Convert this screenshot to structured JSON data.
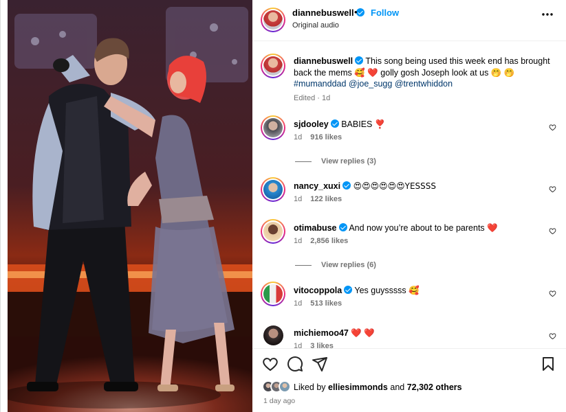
{
  "post": {
    "author": "diannebuswell",
    "follow_label": "Follow",
    "separator": "•",
    "audio": "Original audio",
    "more_label": "•••"
  },
  "caption": {
    "author": "diannebuswell",
    "text": "This song being used this week end has brought back the mems 🥰 ❤️ golly gosh Joseph look at us 🤭 🤭",
    "tags": "#mumanddad @joe_sugg @trentwhiddon",
    "meta": "Edited · 1d"
  },
  "comments": [
    {
      "user": "sjdooley",
      "verified": true,
      "text": "BABIES ❣️",
      "time": "1d",
      "likes": "916 likes",
      "replies": "View replies (3)"
    },
    {
      "user": "nancy_xuxi",
      "verified": true,
      "text": "😍😍😍😍😍😍YESSSS",
      "time": "1d",
      "likes": "122 likes"
    },
    {
      "user": "otimabuse",
      "verified": true,
      "text": "And now you’re about to be parents ❤️",
      "time": "1d",
      "likes": "2,856 likes",
      "replies": "View replies (6)"
    },
    {
      "user": "vitocoppola",
      "verified": true,
      "text": "Yes guysssss 🥰",
      "time": "1d",
      "likes": "513 likes"
    },
    {
      "user": "michiemoo47",
      "verified": false,
      "text": "❤️ ❤️",
      "time": "1d",
      "likes": "3 likes"
    }
  ],
  "footer": {
    "liked_prefix": "Liked by",
    "liked_user": "elliesimmonds",
    "liked_and": "and",
    "liked_others": "72,302 others",
    "date": "1 day ago"
  },
  "icons": {
    "verified": "verified-badge-icon",
    "like": "heart-icon",
    "comment": "comment-bubble-icon",
    "share": "paper-plane-icon",
    "save": "bookmark-icon",
    "more": "more-dots-icon"
  },
  "colors": {
    "link_blue": "#0095f6",
    "tag_blue": "#00376b",
    "muted": "#737373",
    "heart_red": "#ed4956"
  }
}
